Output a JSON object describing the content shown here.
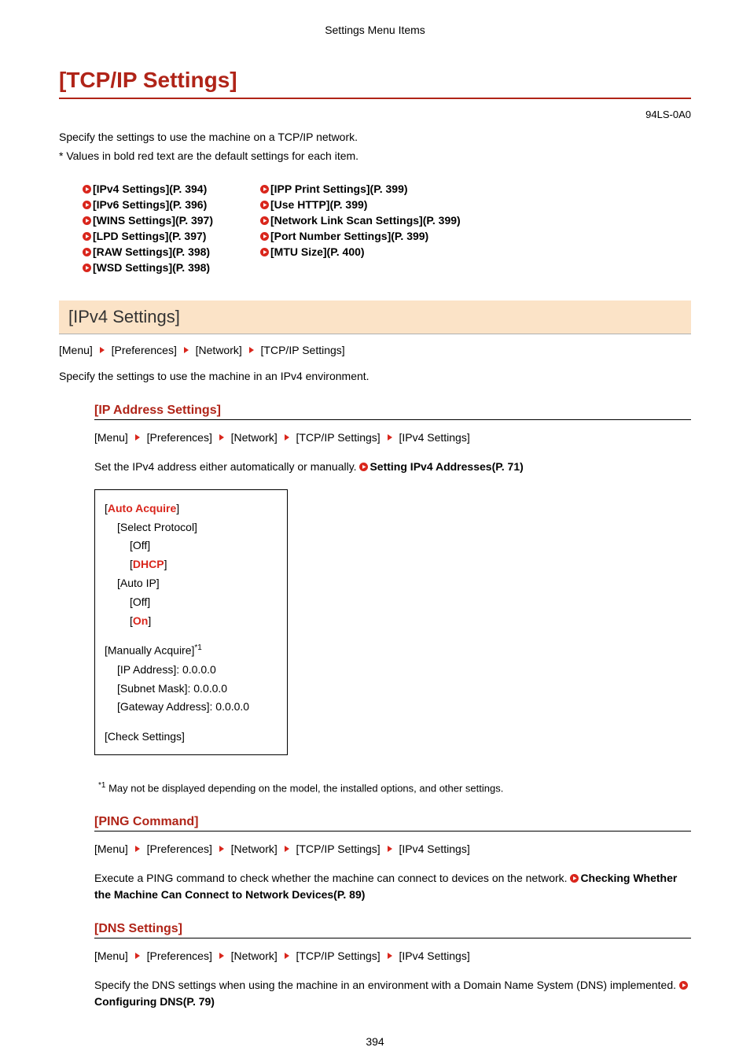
{
  "header": {
    "text": "Settings Menu Items"
  },
  "title": "[TCP/IP Settings]",
  "doc_code": "94LS-0A0",
  "intro": {
    "line1": "Specify the settings to use the machine on a TCP/IP network.",
    "line2": "* Values in bold red text are the default settings for each item."
  },
  "toc": {
    "col1": [
      "[IPv4 Settings](P. 394)",
      "[IPv6 Settings](P. 396)",
      "[WINS Settings](P. 397)",
      "[LPD Settings](P. 397)",
      "[RAW Settings](P. 398)",
      "[WSD Settings](P. 398)"
    ],
    "col2": [
      "[IPP Print Settings](P. 399)",
      "[Use HTTP](P. 399)",
      "[Network Link Scan Settings](P. 399)",
      "[Port Number Settings](P. 399)",
      "[MTU Size](P. 400)"
    ]
  },
  "section": {
    "heading": "[IPv4 Settings]",
    "breadcrumb": [
      "[Menu]",
      "[Preferences]",
      "[Network]",
      "[TCP/IP Settings]"
    ],
    "desc": "Specify the settings to use the machine in an IPv4 environment."
  },
  "sub_ip": {
    "heading": "[IP Address Settings]",
    "breadcrumb": [
      "[Menu]",
      "[Preferences]",
      "[Network]",
      "[TCP/IP Settings]",
      "[IPv4 Settings]"
    ],
    "desc_prefix": "Set the IPv4 address either automatically or manually. ",
    "xref": "Setting IPv4 Addresses(P. 71)",
    "box": {
      "auto_acquire": {
        "label": "Auto Acquire"
      },
      "select_protocol": {
        "label": "[Select Protocol]",
        "off": "[Off]",
        "dhcp": "DHCP"
      },
      "auto_ip": {
        "label": "[Auto IP]",
        "off": "[Off]",
        "on": "On"
      },
      "manually_acquire": {
        "label": "[Manually Acquire]",
        "sup": "*1",
        "ip": "[IP Address]: 0.0.0.0",
        "subnet": "[Subnet Mask]: 0.0.0.0",
        "gateway": "[Gateway Address]: 0.0.0.0"
      },
      "check": "[Check Settings]"
    },
    "footnote": {
      "sup": "*1",
      "text": " May not be displayed depending on the model, the installed options, and other settings."
    }
  },
  "sub_ping": {
    "heading": "[PING Command]",
    "breadcrumb": [
      "[Menu]",
      "[Preferences]",
      "[Network]",
      "[TCP/IP Settings]",
      "[IPv4 Settings]"
    ],
    "desc_prefix": "Execute a PING command to check whether the machine can connect to devices on the network. ",
    "xref": "Checking Whether the Machine Can Connect to Network Devices(P. 89)"
  },
  "sub_dns": {
    "heading": "[DNS Settings]",
    "breadcrumb": [
      "[Menu]",
      "[Preferences]",
      "[Network]",
      "[TCP/IP Settings]",
      "[IPv4 Settings]"
    ],
    "desc_prefix": "Specify the DNS settings when using the machine in an environment with a Domain Name System (DNS) implemented. ",
    "xref": "Configuring DNS(P. 79)"
  },
  "page_number": "394"
}
